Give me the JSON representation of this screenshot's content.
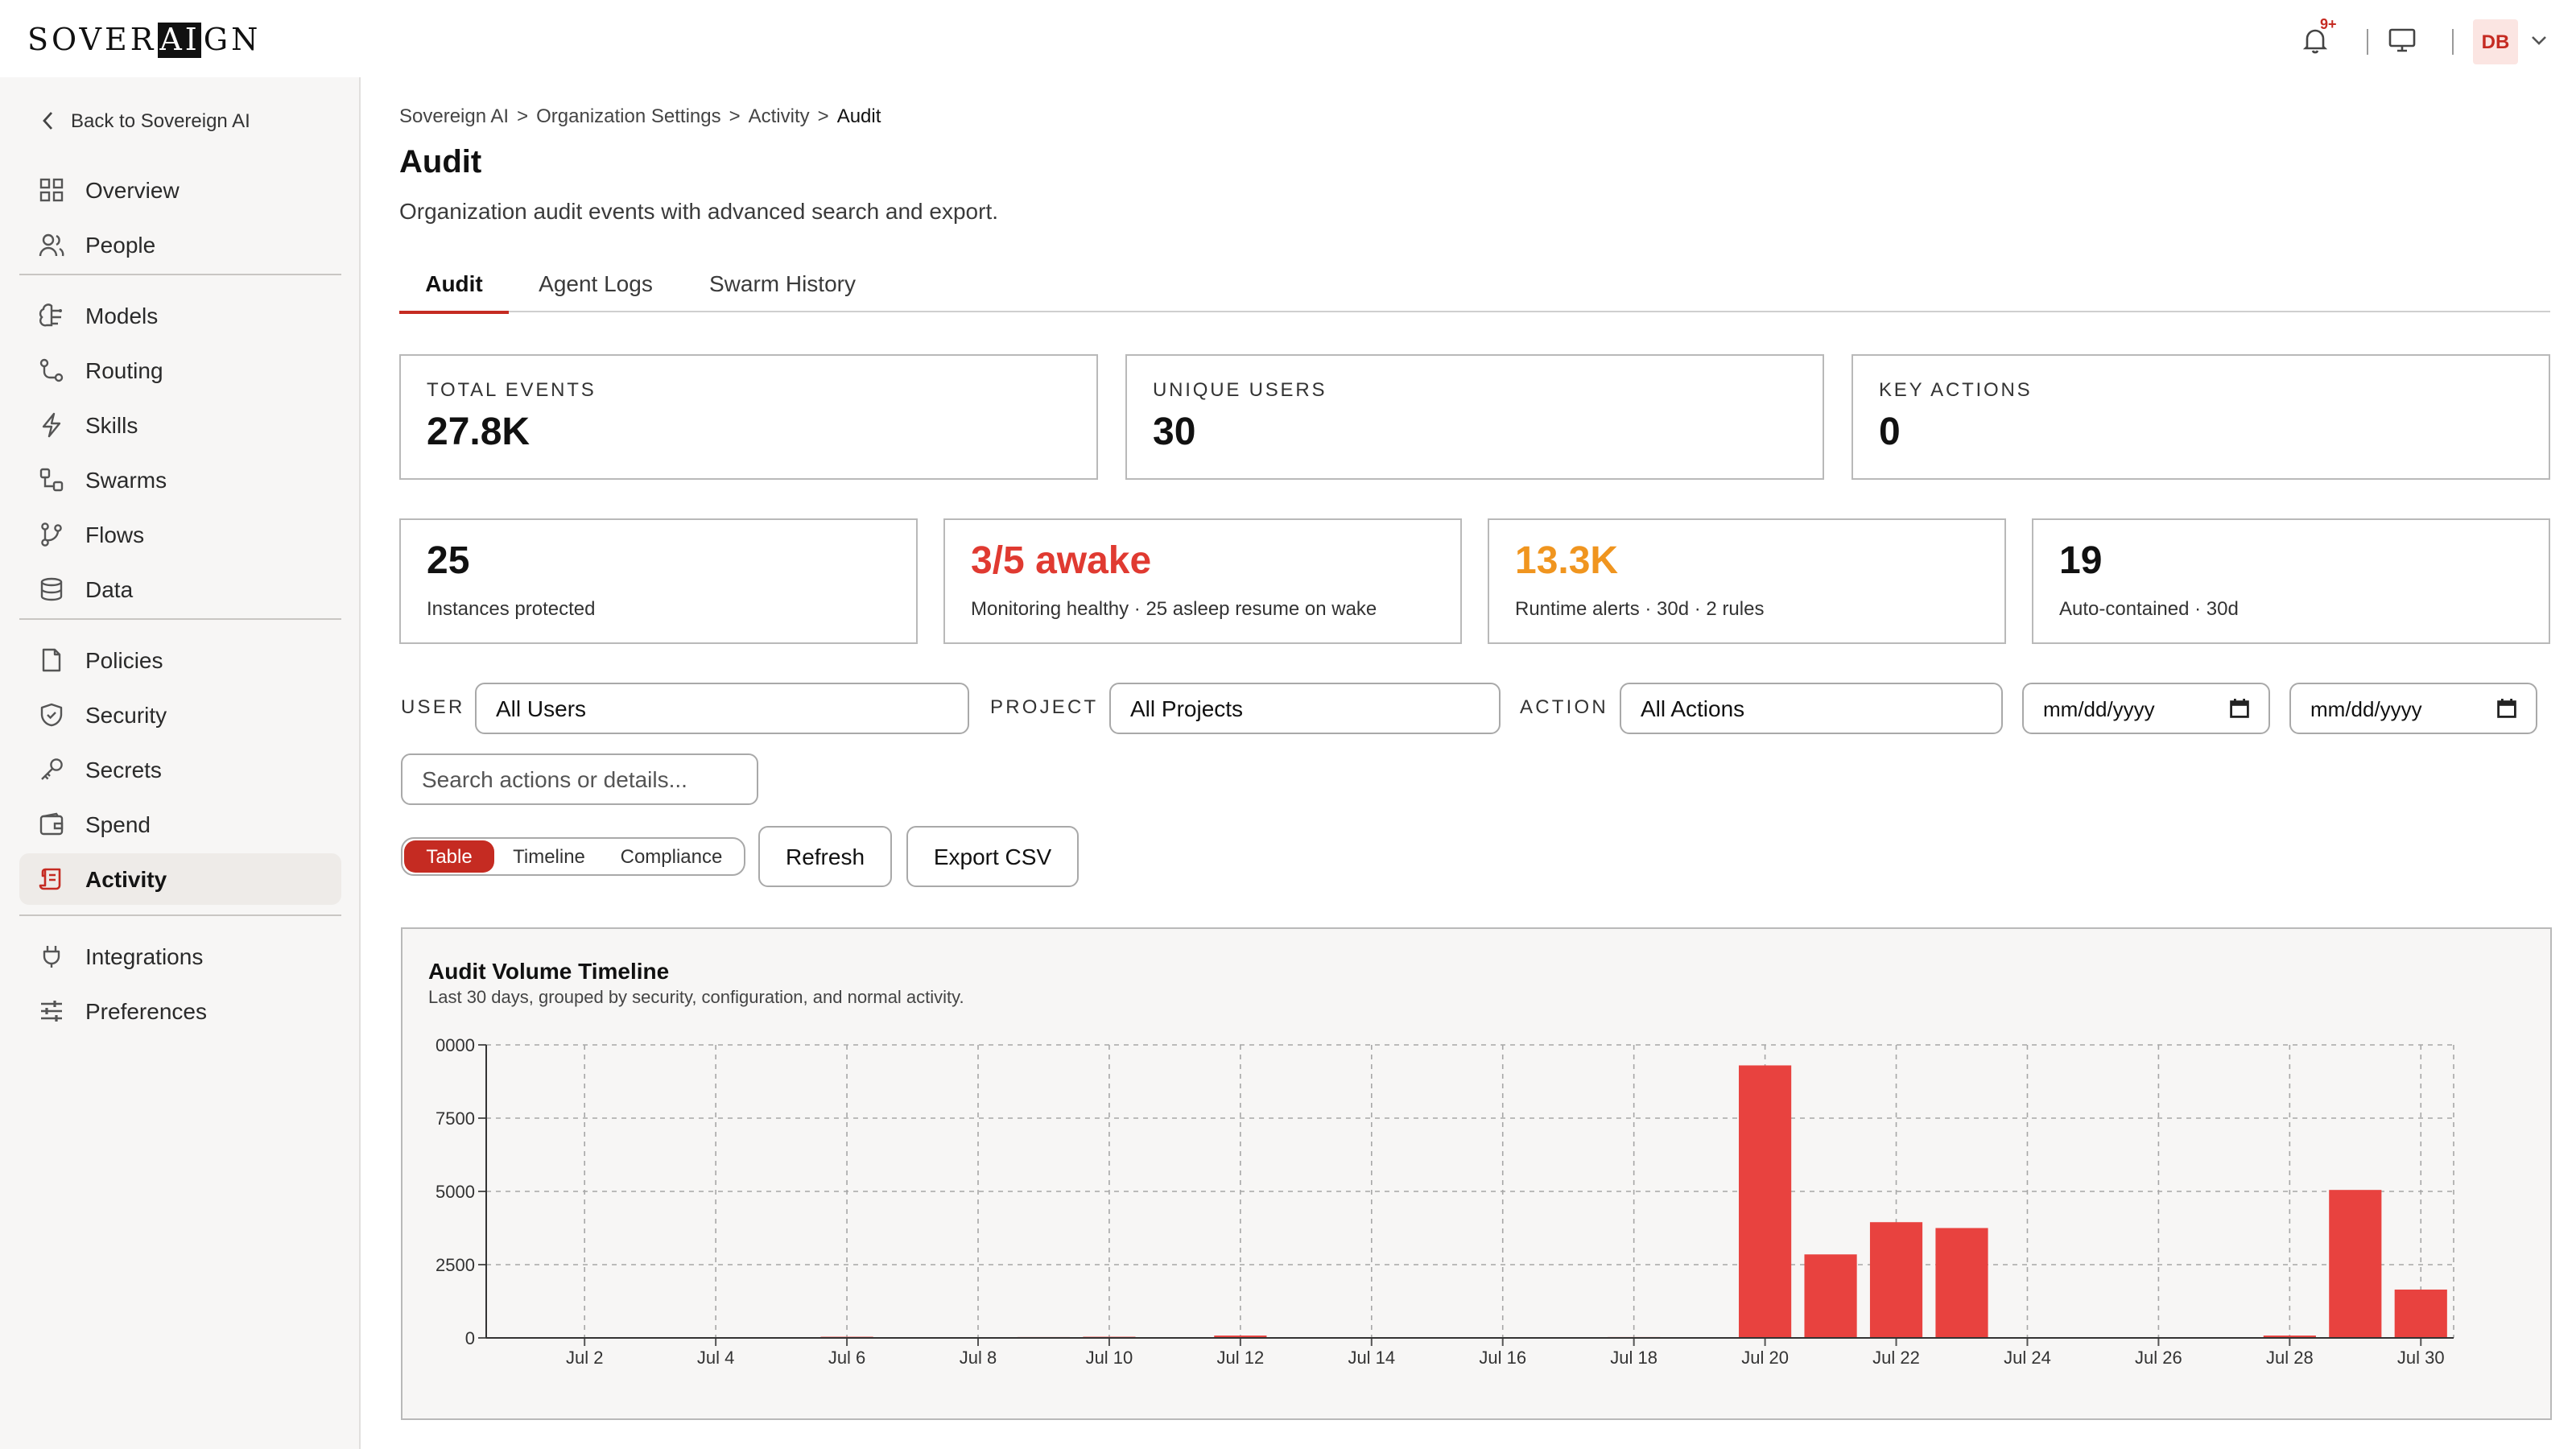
{
  "topbar": {
    "logo_pre": "SOVER",
    "logo_hl": "AI",
    "logo_post": "GN",
    "notifications_badge": "9+",
    "avatar_initials": "DB"
  },
  "sidebar": {
    "back_label": "Back to Sovereign AI",
    "items": [
      {
        "label": "Overview",
        "icon": "grid-icon"
      },
      {
        "label": "People",
        "icon": "people-icon"
      },
      {
        "label": "Models",
        "icon": "brain-icon"
      },
      {
        "label": "Routing",
        "icon": "route-icon"
      },
      {
        "label": "Skills",
        "icon": "bolt-icon"
      },
      {
        "label": "Swarms",
        "icon": "swarm-icon"
      },
      {
        "label": "Flows",
        "icon": "branch-icon"
      },
      {
        "label": "Data",
        "icon": "database-icon"
      },
      {
        "label": "Policies",
        "icon": "document-icon"
      },
      {
        "label": "Security",
        "icon": "shield-icon"
      },
      {
        "label": "Secrets",
        "icon": "key-icon"
      },
      {
        "label": "Spend",
        "icon": "wallet-icon"
      },
      {
        "label": "Activity",
        "icon": "scroll-icon",
        "active": true
      },
      {
        "label": "Integrations",
        "icon": "plug-icon"
      },
      {
        "label": "Preferences",
        "icon": "sliders-icon"
      }
    ]
  },
  "breadcrumb": {
    "items": [
      "Sovereign AI",
      "Organization Settings",
      "Activity",
      "Audit"
    ],
    "sep": ">"
  },
  "page": {
    "title": "Audit",
    "subtitle": "Organization audit events with advanced search and export."
  },
  "tabs": [
    "Audit",
    "Agent Logs",
    "Swarm History"
  ],
  "stats_top": [
    {
      "label": "TOTAL EVENTS",
      "value": "27.8K"
    },
    {
      "label": "UNIQUE USERS",
      "value": "30"
    },
    {
      "label": "KEY ACTIONS",
      "value": "0"
    }
  ],
  "stats_bottom": [
    {
      "value": "25",
      "caption": "Instances protected",
      "color": "#111111"
    },
    {
      "value": "3/5 awake",
      "caption": "Monitoring healthy · 25 asleep resume on wake",
      "color": "#e03a31"
    },
    {
      "value": "13.3K",
      "caption": "Runtime alerts · 30d · 2 rules",
      "color": "#f0951f"
    },
    {
      "value": "19",
      "caption": "Auto-contained · 30d",
      "color": "#111111"
    }
  ],
  "filters": {
    "user_label": "USER",
    "user_value": "All Users",
    "project_label": "PROJECT",
    "project_value": "All Projects",
    "action_label": "ACTION",
    "action_value": "All Actions",
    "date_from_placeholder": "mm/dd/yyyy",
    "date_to_placeholder": "mm/dd/yyyy",
    "search_placeholder": "Search actions or details..."
  },
  "view_toggle": [
    "Table",
    "Timeline",
    "Compliance"
  ],
  "buttons": {
    "refresh": "Refresh",
    "export": "Export CSV"
  },
  "colors": {
    "accent": "#c52b22",
    "bar": "#e8423f"
  },
  "chart": {
    "title": "Audit Volume Timeline",
    "subtitle": "Last 30 days, grouped by security, configuration, and normal activity."
  },
  "chart_data": {
    "type": "bar",
    "title": "Audit Volume Timeline",
    "subtitle": "Last 30 days, grouped by security, configuration, and normal activity.",
    "categories": [
      "Jul 1",
      "Jul 2",
      "Jul 3",
      "Jul 4",
      "Jul 5",
      "Jul 6",
      "Jul 7",
      "Jul 8",
      "Jul 9",
      "Jul 10",
      "Jul 11",
      "Jul 12",
      "Jul 13",
      "Jul 14",
      "Jul 15",
      "Jul 16",
      "Jul 17",
      "Jul 18",
      "Jul 19",
      "Jul 20",
      "Jul 21",
      "Jul 22",
      "Jul 23",
      "Jul 24",
      "Jul 25",
      "Jul 26",
      "Jul 27",
      "Jul 28",
      "Jul 29",
      "Jul 30"
    ],
    "values": [
      0,
      0,
      0,
      0,
      0,
      40,
      0,
      0,
      30,
      40,
      0,
      80,
      0,
      10,
      0,
      0,
      20,
      30,
      0,
      9300,
      2850,
      3950,
      3750,
      20,
      10,
      0,
      10,
      80,
      5050,
      1650
    ],
    "x_tick_labels": [
      "Jul 2",
      "Jul 4",
      "Jul 6",
      "Jul 8",
      "Jul 10",
      "Jul 12",
      "Jul 14",
      "Jul 16",
      "Jul 18",
      "Jul 20",
      "Jul 22",
      "Jul 24",
      "Jul 26",
      "Jul 28",
      "Jul 30"
    ],
    "y_tick_labels": [
      "0",
      "2500",
      "5000",
      "7500",
      "0000"
    ],
    "y_ticks": [
      0,
      2500,
      5000,
      7500,
      10000
    ],
    "ylim": [
      0,
      10000
    ],
    "grid": true,
    "xlabel": "",
    "ylabel": ""
  }
}
